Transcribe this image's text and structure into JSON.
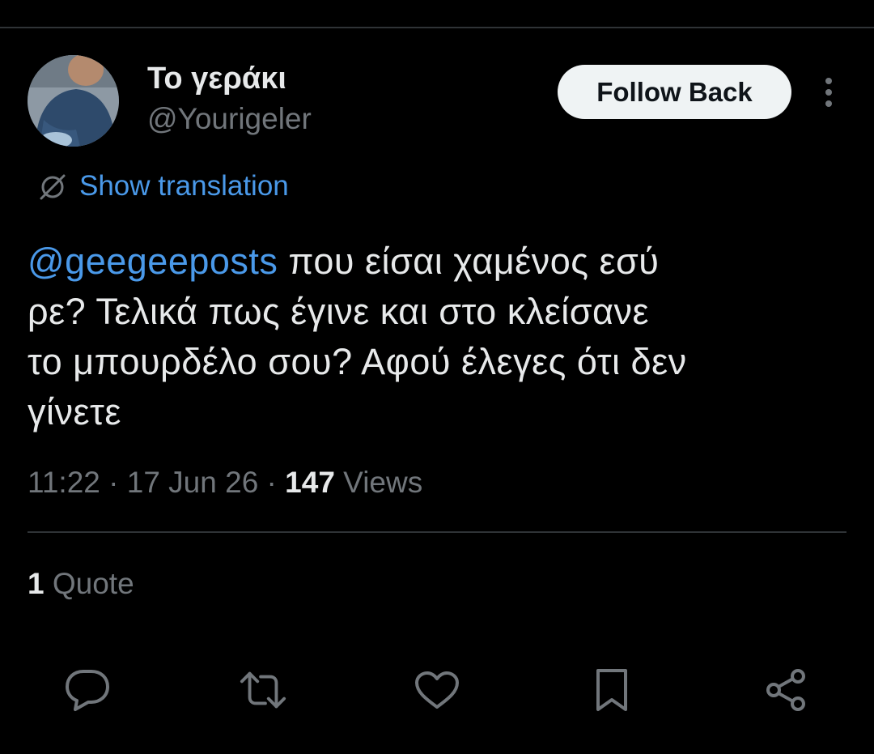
{
  "author": {
    "display_name": "Το γεράκι",
    "handle": "@Yourigeler"
  },
  "follow_button": {
    "label": "Follow Back"
  },
  "translation": {
    "label": "Show translation"
  },
  "tweet": {
    "mention": "@geegeeposts",
    "line1_rest": " που είσαι χαμένος εσύ",
    "line2": "ρε? Τελικά  πως έγινε και στο κλείσανε",
    "line3": "το μπουρδέλο σου? Αφού έλεγες ότι δεν",
    "line4": "γίνετε"
  },
  "meta": {
    "time": "11:22",
    "separator": " · ",
    "date": "17 Jun 26",
    "views_count": "147",
    "views_label": " Views"
  },
  "quotes": {
    "count": "1",
    "label": " Quote"
  },
  "actions": [
    "reply-icon",
    "retweet-icon",
    "like-icon",
    "bookmark-icon",
    "share-icon"
  ],
  "colors": {
    "background": "#000000",
    "text_primary": "#e7e9ea",
    "text_secondary": "#71767b",
    "link": "#4a99e9",
    "divider": "#2f3336",
    "button_bg": "#eff3f4"
  }
}
